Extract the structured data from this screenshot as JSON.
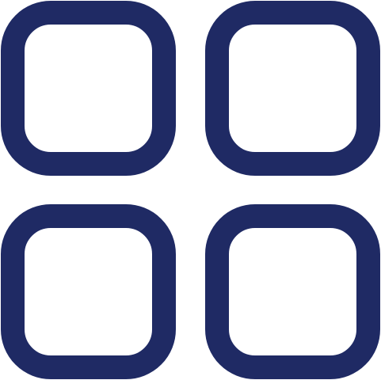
{
  "icon": {
    "name": "grid-icon",
    "description_hidden": "",
    "color": "#1F2A64",
    "tiles": [
      {
        "name": "grid-tile-top-left"
      },
      {
        "name": "grid-tile-top-right"
      },
      {
        "name": "grid-tile-bottom-left"
      },
      {
        "name": "grid-tile-bottom-right"
      }
    ]
  }
}
